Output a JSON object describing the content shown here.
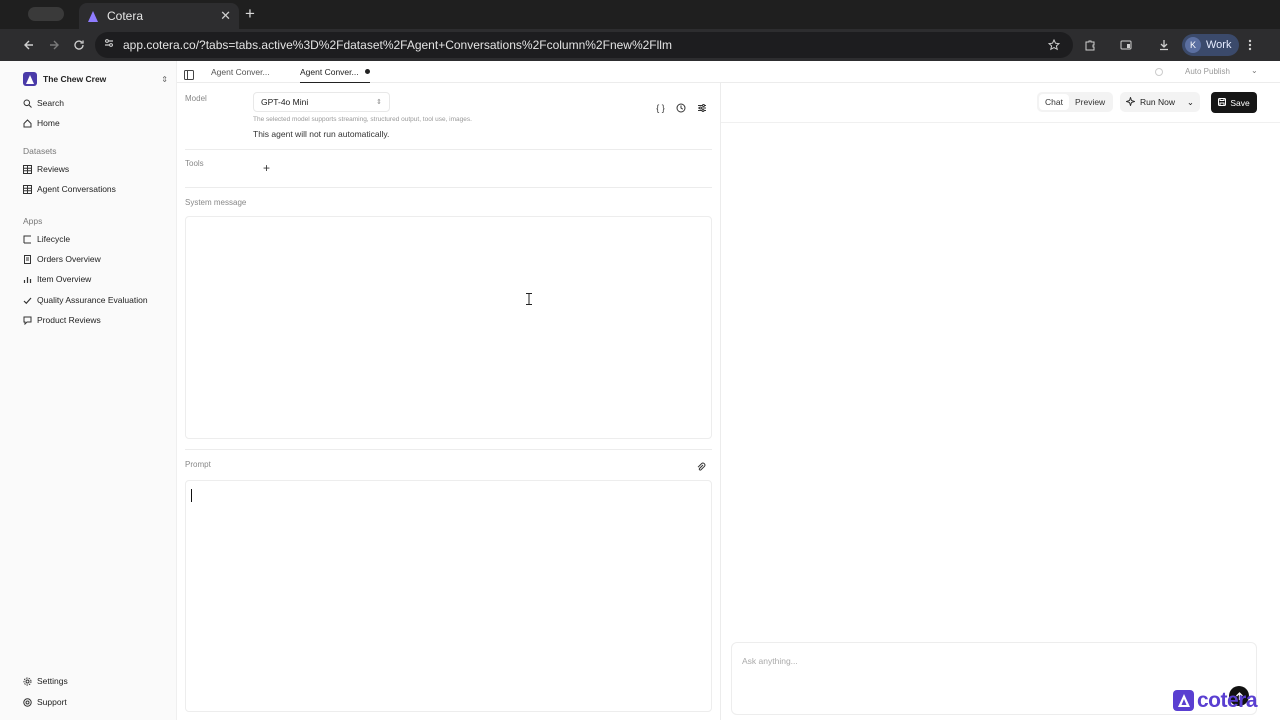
{
  "browser": {
    "tab_title": "Cotera",
    "url": "app.cotera.co/?tabs=tabs.active%3D%2Fdataset%2FAgent+Conversations%2Fcolumn%2Fnew%2Fllm",
    "profile_initial": "K",
    "profile_name": "Work"
  },
  "sidebar": {
    "workspace": "The Chew Crew",
    "top_items": [
      {
        "label": "Search",
        "icon": "search-icon"
      },
      {
        "label": "Home",
        "icon": "home-icon"
      }
    ],
    "datasets_label": "Datasets",
    "datasets": [
      {
        "label": "Reviews",
        "icon": "table-icon"
      },
      {
        "label": "Agent Conversations",
        "icon": "table-icon"
      }
    ],
    "apps_label": "Apps",
    "apps": [
      {
        "label": "Lifecycle",
        "icon": "lifecycle-icon"
      },
      {
        "label": "Orders Overview",
        "icon": "document-icon"
      },
      {
        "label": "Item Overview",
        "icon": "bar-chart-icon"
      },
      {
        "label": "Quality Assurance Evaluation",
        "icon": "check-icon"
      },
      {
        "label": "Product Reviews",
        "icon": "chat-bubble-icon"
      }
    ],
    "bottom_items": [
      {
        "label": "Settings",
        "icon": "gear-icon"
      },
      {
        "label": "Support",
        "icon": "support-icon"
      }
    ]
  },
  "tabs": [
    {
      "label": "Agent Conver...",
      "active": false
    },
    {
      "label": "Agent Conver...",
      "active": true,
      "unsaved": true
    }
  ],
  "auto_publish_label": "Auto Publish",
  "editor": {
    "model_label": "Model",
    "model_value": "GPT-4o Mini",
    "model_note": "The selected model supports streaming, structured output, tool use, images.",
    "model_status": "This agent will not run automatically.",
    "tools_label": "Tools",
    "add_tool": "+",
    "system_label": "System message",
    "system_value": "",
    "prompt_label": "Prompt",
    "prompt_value": ""
  },
  "chat": {
    "mode_chat": "Chat",
    "mode_preview": "Preview",
    "run_now": "Run Now",
    "save": "Save",
    "input_placeholder": "Ask anything..."
  },
  "watermark": "cotera",
  "colors": {
    "brand": "#5a3fd1",
    "save_bg": "#161616"
  }
}
